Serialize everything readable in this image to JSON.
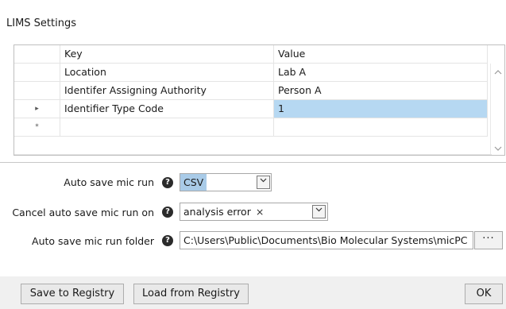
{
  "window": {
    "title": "LIMS Settings"
  },
  "grid": {
    "columns": {
      "key": "Key",
      "value": "Value"
    },
    "rows": [
      {
        "marker": "",
        "key": "Location",
        "value": "Lab A"
      },
      {
        "marker": "",
        "key": "Identifer Assigning Authority",
        "value": "Person A"
      },
      {
        "marker": "▸",
        "key": "Identifier Type Code",
        "value": "1",
        "selected": true
      },
      {
        "marker": "*",
        "key": "",
        "value": ""
      }
    ]
  },
  "form": {
    "auto_save": {
      "label": "Auto save mic run",
      "value": "CSV"
    },
    "cancel_auto_save": {
      "label": "Cancel auto save mic run on",
      "chip": "analysis error",
      "chip_remove": "×"
    },
    "folder": {
      "label": "Auto save mic run folder",
      "value": "C:\\Users\\Public\\Documents\\Bio Molecular Systems\\micPC",
      "browse_label": "···"
    },
    "help_glyph": "?"
  },
  "buttons": {
    "save_registry": "Save to Registry",
    "load_registry": "Load from Registry",
    "ok": "OK"
  },
  "icons": {
    "help": "help-circle-icon",
    "dropdown": "chevron-down-icon",
    "scroll_up": "chevron-up-icon",
    "scroll_down": "chevron-down-icon"
  },
  "colors": {
    "selection": "#b6d8f2",
    "combo_highlight": "#a9cbe8",
    "bottom_bar": "#f0f0f0"
  }
}
